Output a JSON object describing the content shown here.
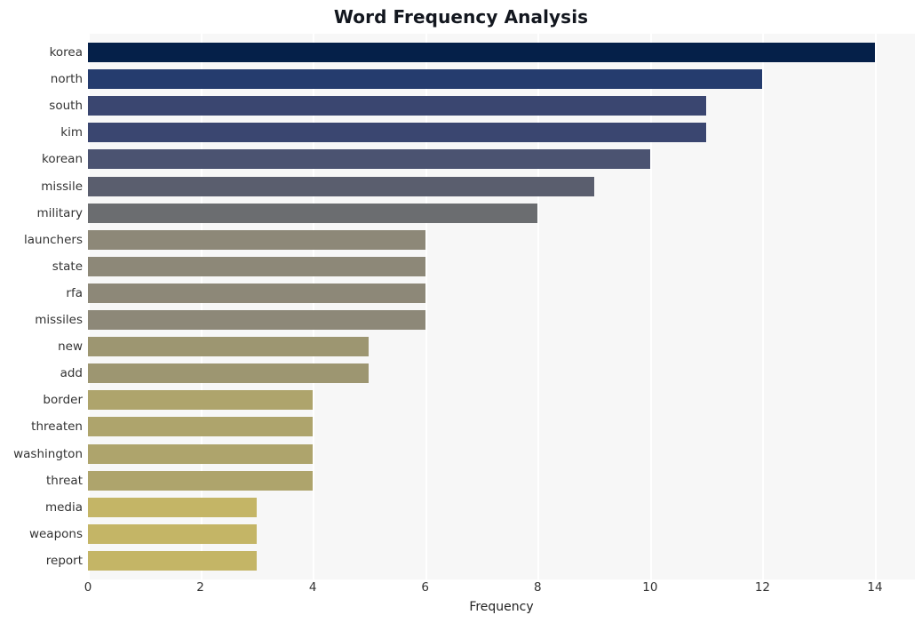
{
  "chart_data": {
    "type": "bar",
    "orientation": "horizontal",
    "title": "Word Frequency Analysis",
    "xlabel": "Frequency",
    "ylabel": "",
    "xlim": [
      0,
      14
    ],
    "x_ticks": [
      "0",
      "2",
      "4",
      "6",
      "8",
      "10",
      "12",
      "14"
    ],
    "x_tick_values": [
      0,
      2,
      4,
      6,
      8,
      10,
      12,
      14
    ],
    "grid": "vertical-only",
    "legend": "none",
    "categories": [
      "korea",
      "north",
      "south",
      "kim",
      "korean",
      "missile",
      "military",
      "launchers",
      "state",
      "rfa",
      "missiles",
      "new",
      "add",
      "border",
      "threaten",
      "washington",
      "threat",
      "media",
      "weapons",
      "report"
    ],
    "values": [
      14,
      12,
      11,
      11,
      10,
      9,
      8,
      6,
      6,
      6,
      6,
      5,
      5,
      4,
      4,
      4,
      4,
      3,
      3,
      3
    ],
    "bar_colors": [
      "#052049",
      "#253c6e",
      "#3a4670",
      "#3a4670",
      "#4b5371",
      "#5a5e6e",
      "#6b6d70",
      "#8d8878",
      "#8d8878",
      "#8d8878",
      "#8d8878",
      "#9d9671",
      "#9d9671",
      "#aea46c",
      "#aea46c",
      "#aea46c",
      "#aea46c",
      "#c4b566",
      "#c4b566",
      "#c4b566"
    ]
  },
  "style": {
    "plot_background": "#f7f7f7",
    "figure_background": "#ffffff",
    "gridline_color": "#ffffff",
    "tick_label_color": "#333333",
    "title_color": "#13171f"
  }
}
